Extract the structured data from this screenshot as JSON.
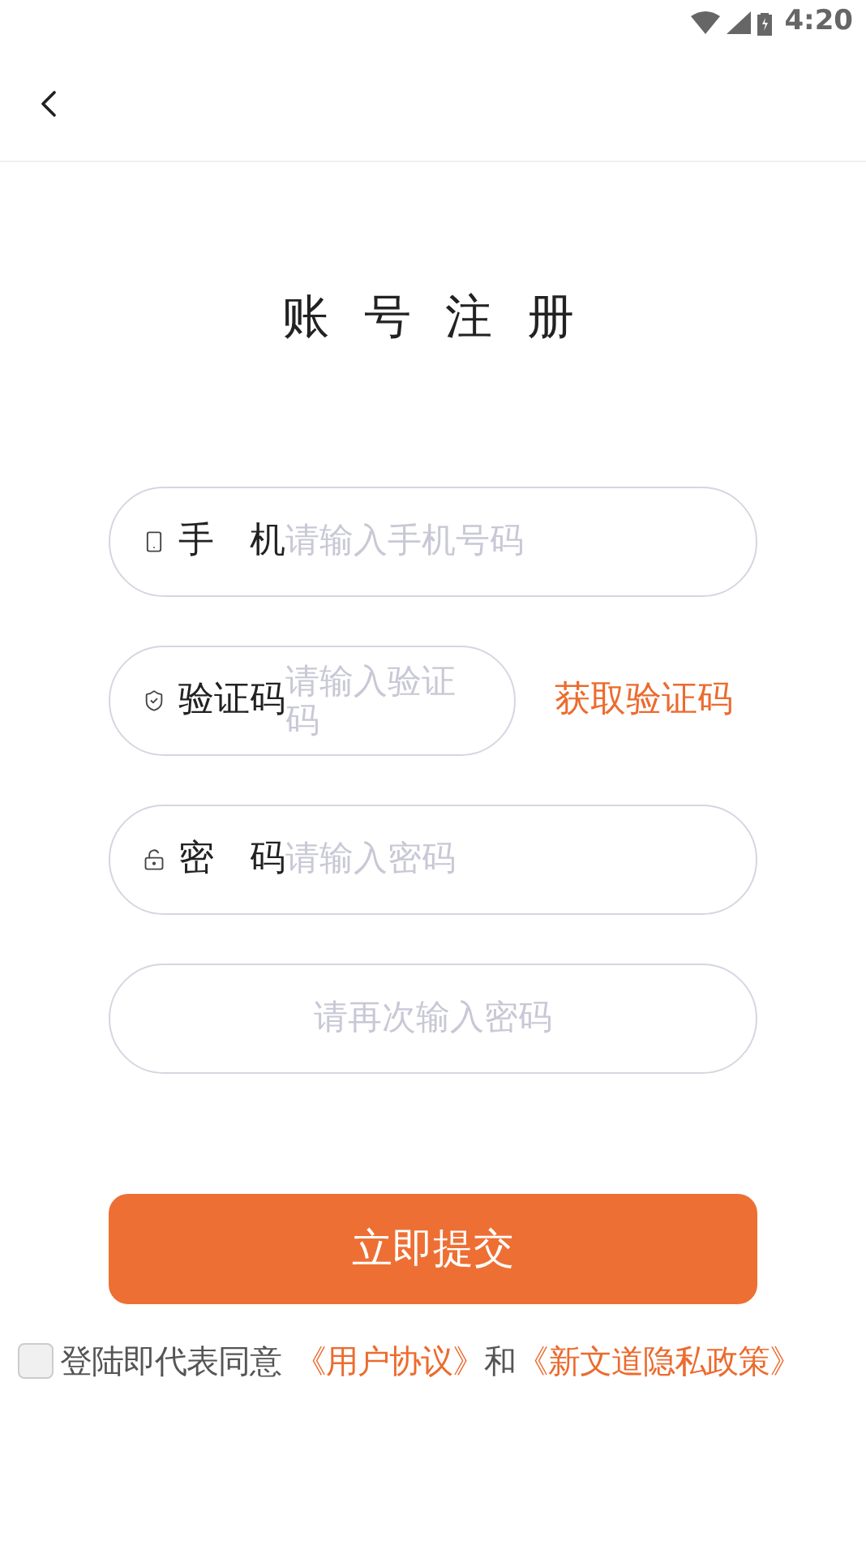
{
  "status_bar": {
    "time": "4:20"
  },
  "title": "账 号 注 册",
  "fields": [
    {
      "kind": "phone",
      "label": "手　机",
      "placeholder": "请输入手机号码"
    },
    {
      "kind": "code",
      "label": "验证码",
      "placeholder": "请输入验证码",
      "action": "获取验证码"
    },
    {
      "kind": "password",
      "label": "密　码",
      "placeholder": "请输入密码"
    },
    {
      "kind": "confirm",
      "placeholder": "请再次输入密码"
    }
  ],
  "submit": "立即提交",
  "agreement": {
    "checked": false,
    "text": "登陆即代表同意",
    "link_1": "《用户协议》",
    "joiner": "和",
    "link_2": "《新文道隐私政策》"
  }
}
